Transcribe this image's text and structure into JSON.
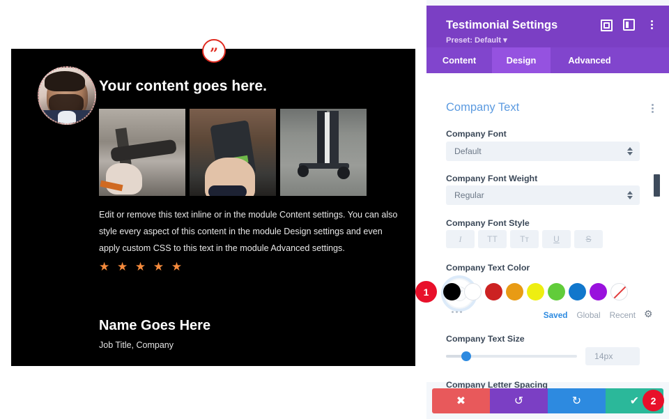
{
  "preview": {
    "quote_icon": "quote-mark-icon",
    "avatar_alt": "bearded-man-portrait",
    "title": "Your content goes here.",
    "images": [
      {
        "name": "scooter-handlebar-photo"
      },
      {
        "name": "hand-holding-phone-photo"
      },
      {
        "name": "person-riding-scooter-photo"
      }
    ],
    "body": "Edit or remove this text inline or in the module Content settings. You can also style every aspect of this content in the module Design settings and even apply custom CSS to this text in the module Advanced settings.",
    "stars": "★ ★ ★ ★ ★",
    "star_count": 5,
    "star_color": "#f58a3c",
    "name": "Name Goes Here",
    "position": "Job Title, Company",
    "card_background": "#000000"
  },
  "panel": {
    "title": "Testimonial Settings",
    "preset": "Preset: Default ▾",
    "header_color": "#7b3fc4",
    "header_icons": [
      {
        "name": "fullscreen-icon"
      },
      {
        "name": "layout-toggle-icon"
      },
      {
        "name": "more-options-icon"
      }
    ],
    "tabs": [
      {
        "label": "Content",
        "active": false
      },
      {
        "label": "Design",
        "active": true
      },
      {
        "label": "Advanced",
        "active": false
      }
    ],
    "section": {
      "title": "Company Text",
      "accent_color": "#5b9ae0"
    },
    "fields": {
      "font_label": "Company Font",
      "font_value": "Default",
      "weight_label": "Company Font Weight",
      "weight_value": "Regular",
      "style_label": "Company Font Style",
      "style_buttons": [
        {
          "name": "italic-button",
          "glyph": "I"
        },
        {
          "name": "uppercase-button",
          "glyph": "TT"
        },
        {
          "name": "small-caps-button",
          "glyph": "Tᴛ"
        },
        {
          "name": "underline-button",
          "glyph": "U"
        },
        {
          "name": "strikethrough-button",
          "glyph": "S"
        }
      ],
      "color_label": "Company Text Color",
      "size_label": "Company Text Size",
      "size_value": "14px",
      "letter_spacing_label": "Company Letter Spacing"
    },
    "swatches": [
      {
        "name": "swatch-black",
        "hex": "#000000"
      },
      {
        "name": "swatch-white",
        "hex": "#ffffff"
      },
      {
        "name": "swatch-red",
        "hex": "#cc2222"
      },
      {
        "name": "swatch-orange",
        "hex": "#e89b14"
      },
      {
        "name": "swatch-yellow",
        "hex": "#eeee11"
      },
      {
        "name": "swatch-green",
        "hex": "#61cc3a"
      },
      {
        "name": "swatch-blue",
        "hex": "#1177cc"
      },
      {
        "name": "swatch-purple",
        "hex": "#9911dd"
      },
      {
        "name": "swatch-none",
        "hex": "none"
      }
    ],
    "color_tabs": [
      {
        "label": "Saved",
        "active": true
      },
      {
        "label": "Global",
        "active": false
      },
      {
        "label": "Recent",
        "active": false
      }
    ],
    "gear": "gear-icon",
    "actions": [
      {
        "name": "cancel-button",
        "glyph": "✖",
        "color": "#e8595b"
      },
      {
        "name": "undo-button",
        "glyph": "↺",
        "color": "#7b3fc4"
      },
      {
        "name": "redo-button",
        "glyph": "↻",
        "color": "#2d8ae0"
      },
      {
        "name": "save-button",
        "glyph": "✔",
        "color": "#2bb89a"
      }
    ]
  },
  "markers": [
    {
      "label": "1"
    },
    {
      "label": "2"
    }
  ]
}
